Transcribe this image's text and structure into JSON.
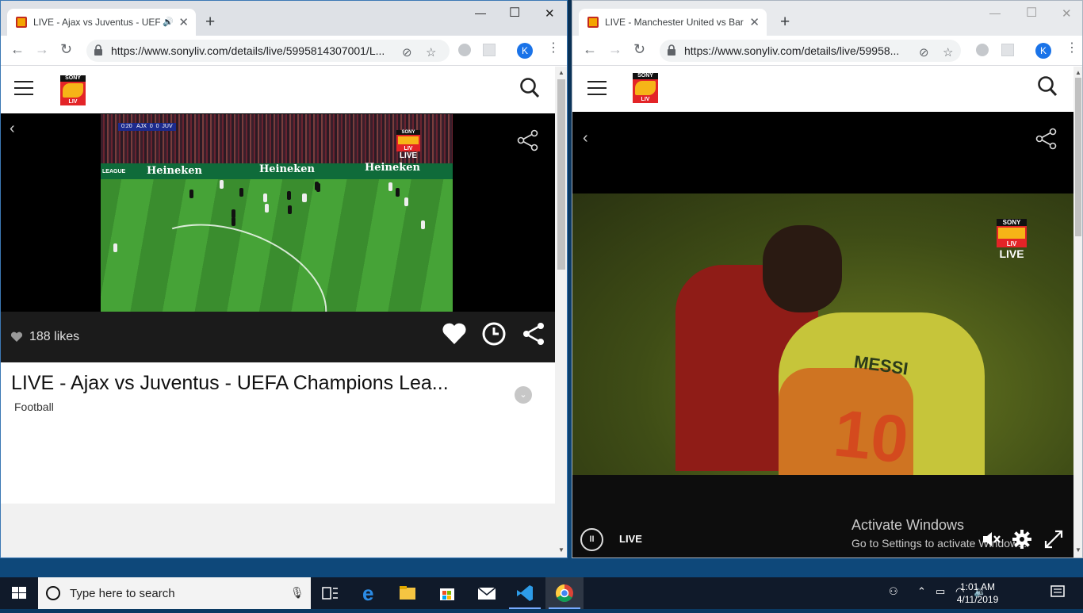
{
  "left_window": {
    "tab_title": "LIVE - Ajax vs Juventus - UEFA",
    "url": "https://www.sonyliv.com/details/live/5995814307001/L...",
    "profile_initial": "K",
    "new_tab": "+",
    "likes": "188 likes",
    "title": "LIVE - Ajax vs Juventus - UEFA Champions Lea...",
    "category": "Football",
    "video": {
      "clock": "0:20",
      "team_home": "AJX",
      "score_home": "0",
      "score_away": "0",
      "team_away": "JUV",
      "ad_text": "Heineken",
      "league_text": "LEAGUE",
      "watermark_top": "SONY",
      "watermark_mid": "LIV",
      "watermark_live": "LIVE"
    }
  },
  "right_window": {
    "tab_title": "LIVE - Manchester United vs Barc",
    "url": "https://www.sonyliv.com/details/live/59958...",
    "profile_initial": "K",
    "new_tab": "+",
    "live_label": "LIVE",
    "video": {
      "jersey_name": "MESSI",
      "jersey_number": "10",
      "watermark_top": "SONY",
      "watermark_mid": "LIV",
      "watermark_live": "LIVE"
    },
    "activate_title": "Activate Windows",
    "activate_sub": "Go to Settings to activate Windows."
  },
  "logo": {
    "top": "SONY",
    "bottom": "LIV"
  },
  "taskbar": {
    "search_placeholder": "Type here to search",
    "time": "1:01 AM",
    "date": "4/11/2019"
  },
  "colors": {
    "brand_red": "#e32427",
    "brand_yellow": "#f6b417",
    "chrome_blue": "#1a73e8",
    "taskbar": "#101a2a"
  }
}
